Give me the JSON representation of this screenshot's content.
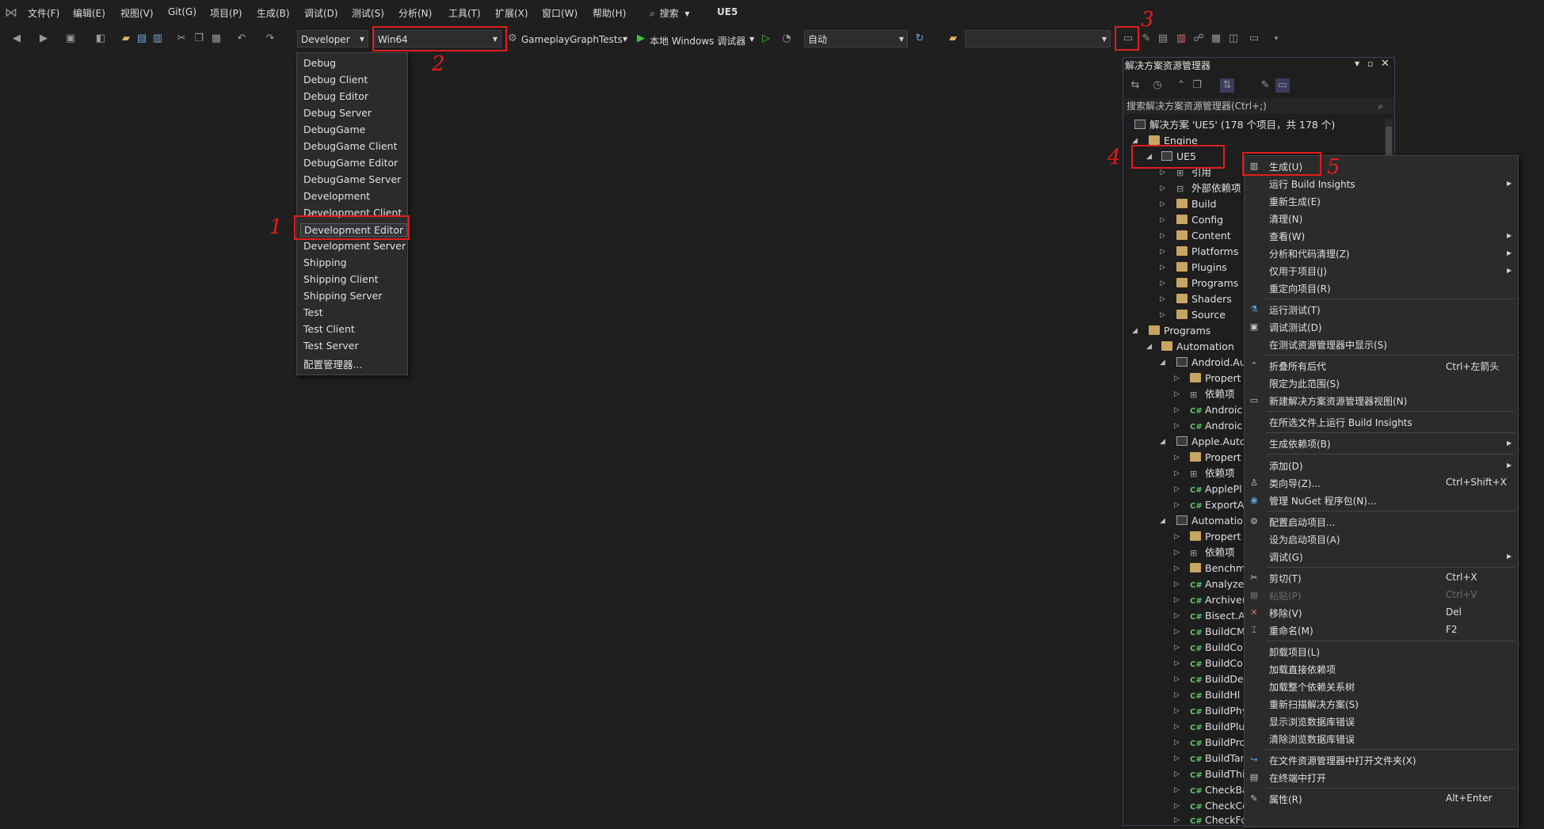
{
  "menubar": {
    "items": [
      "文件(F)",
      "编辑(E)",
      "视图(V)",
      "Git(G)",
      "项目(P)",
      "生成(B)",
      "调试(D)",
      "测试(S)",
      "分析(N)",
      "工具(T)",
      "扩展(X)",
      "窗口(W)",
      "帮助(H)"
    ],
    "search_label": "搜索",
    "title": "UE5"
  },
  "toolbar": {
    "config_value": "Developer",
    "platform_value": "Win64",
    "startup_project": "GameplayGraphTests",
    "debugger_label": "本地 Windows 调试器",
    "mode_value": "自动"
  },
  "config_dropdown": {
    "items": [
      "Debug",
      "Debug Client",
      "Debug Editor",
      "Debug Server",
      "DebugGame",
      "DebugGame Client",
      "DebugGame Editor",
      "DebugGame Server",
      "Development",
      "Development Client",
      "Development Editor",
      "Development Server",
      "Shipping",
      "Shipping Client",
      "Shipping Server",
      "Test",
      "Test Client",
      "Test Server",
      "配置管理器..."
    ],
    "selected": "Development Editor"
  },
  "annotations": [
    "1",
    "2",
    "3",
    "4",
    "5"
  ],
  "solution_explorer": {
    "title": "解决方案资源管理器",
    "search_placeholder": "搜索解决方案资源管理器(Ctrl+;)",
    "tree": [
      {
        "label": "解决方案 'UE5' (178 个项目，共 178 个)",
        "kind": "solution"
      },
      {
        "label": "Engine",
        "kind": "folder"
      },
      {
        "label": "UE5",
        "kind": "project"
      },
      {
        "label": "引用",
        "kind": "ref"
      },
      {
        "label": "外部依赖项",
        "kind": "ref"
      },
      {
        "label": "Build",
        "kind": "folder"
      },
      {
        "label": "Config",
        "kind": "folder"
      },
      {
        "label": "Content",
        "kind": "folder"
      },
      {
        "label": "Platforms",
        "kind": "folder"
      },
      {
        "label": "Plugins",
        "kind": "folder"
      },
      {
        "label": "Programs",
        "kind": "folder"
      },
      {
        "label": "Shaders",
        "kind": "folder"
      },
      {
        "label": "Source",
        "kind": "folder"
      },
      {
        "label": "Programs",
        "kind": "folder"
      },
      {
        "label": "Automation",
        "kind": "folder"
      },
      {
        "label": "Android.Au",
        "kind": "project"
      },
      {
        "label": "Propert",
        "kind": "folder"
      },
      {
        "label": "依赖项",
        "kind": "ref"
      },
      {
        "label": "Androic",
        "kind": "cs"
      },
      {
        "label": "Androic",
        "kind": "cs"
      },
      {
        "label": "Apple.Auto",
        "kind": "project"
      },
      {
        "label": "Propert",
        "kind": "folder"
      },
      {
        "label": "依赖项",
        "kind": "ref"
      },
      {
        "label": "ApplePl",
        "kind": "cs"
      },
      {
        "label": "ExportA",
        "kind": "cs"
      },
      {
        "label": "Automatior",
        "kind": "project"
      },
      {
        "label": "Propert",
        "kind": "folder"
      },
      {
        "label": "依赖项",
        "kind": "ref"
      },
      {
        "label": "Benchm",
        "kind": "folder"
      },
      {
        "label": "Analyze",
        "kind": "cs"
      },
      {
        "label": "Archive(",
        "kind": "cs"
      },
      {
        "label": "Bisect.A",
        "kind": "cs"
      },
      {
        "label": "BuildCM",
        "kind": "cs"
      },
      {
        "label": "BuildCo",
        "kind": "cs"
      },
      {
        "label": "BuildCo",
        "kind": "cs"
      },
      {
        "label": "BuildDe",
        "kind": "cs"
      },
      {
        "label": "BuildHl",
        "kind": "cs"
      },
      {
        "label": "BuildPhy",
        "kind": "cs"
      },
      {
        "label": "BuildPlu",
        "kind": "cs"
      },
      {
        "label": "BuildPro",
        "kind": "cs"
      },
      {
        "label": "BuildTar",
        "kind": "cs"
      },
      {
        "label": "BuildThi",
        "kind": "cs"
      },
      {
        "label": "CheckBa",
        "kind": "cs"
      },
      {
        "label": "CheckCopyrightNotice",
        "kind": "cs"
      },
      {
        "label": "CheckForHacks.cs",
        "kind": "cs"
      }
    ]
  },
  "context_menu": {
    "items": [
      {
        "label": "生成(U)",
        "icon": "build-icon"
      },
      {
        "label": "运行 Build Insights",
        "submenu": true
      },
      {
        "label": "重新生成(E)"
      },
      {
        "label": "清理(N)"
      },
      {
        "label": "查看(W)",
        "submenu": true
      },
      {
        "label": "分析和代码清理(Z)",
        "submenu": true
      },
      {
        "label": "仅用于项目(J)",
        "submenu": true
      },
      {
        "label": "重定向项目(R)"
      },
      {
        "label": "运行测试(T)",
        "icon": "test-icon"
      },
      {
        "label": "调试测试(D)",
        "icon": "debug-test-icon"
      },
      {
        "label": "在测试资源管理器中显示(S)"
      },
      {
        "label": "折叠所有后代",
        "shortcut": "Ctrl+左箭头",
        "icon": "collapse-icon"
      },
      {
        "label": "限定为此范围(S)"
      },
      {
        "label": "新建解决方案资源管理器视图(N)",
        "icon": "new-view-icon"
      },
      {
        "label": "在所选文件上运行 Build Insights"
      },
      {
        "label": "生成依赖项(B)",
        "submenu": true
      },
      {
        "label": "添加(D)",
        "submenu": true
      },
      {
        "label": "类向导(Z)...",
        "shortcut": "Ctrl+Shift+X",
        "icon": "class-wizard-icon"
      },
      {
        "label": "管理 NuGet 程序包(N)...",
        "icon": "nuget-icon"
      },
      {
        "label": "配置启动项目...",
        "icon": "gear-icon"
      },
      {
        "label": "设为启动项目(A)"
      },
      {
        "label": "调试(G)",
        "submenu": true
      },
      {
        "label": "剪切(T)",
        "shortcut": "Ctrl+X",
        "icon": "cut-icon"
      },
      {
        "label": "粘贴(P)",
        "shortcut": "Ctrl+V",
        "icon": "paste-icon",
        "disabled": true
      },
      {
        "label": "移除(V)",
        "shortcut": "Del",
        "icon": "remove-icon"
      },
      {
        "label": "重命名(M)",
        "shortcut": "F2",
        "icon": "rename-icon"
      },
      {
        "label": "卸载项目(L)"
      },
      {
        "label": "加载直接依赖项"
      },
      {
        "label": "加载整个依赖关系树"
      },
      {
        "label": "重新扫描解决方案(S)"
      },
      {
        "label": "显示浏览数据库错误"
      },
      {
        "label": "清除浏览数据库错误"
      },
      {
        "label": "在文件资源管理器中打开文件夹(X)",
        "icon": "open-folder-icon"
      },
      {
        "label": "在终端中打开",
        "icon": "terminal-icon"
      },
      {
        "label": "属性(R)",
        "shortcut": "Alt+Enter",
        "icon": "wrench-icon"
      }
    ]
  },
  "colors": {
    "annotation": "#e11d1d",
    "background": "#1f1f1f",
    "menu_bg": "#2b2b2b"
  }
}
